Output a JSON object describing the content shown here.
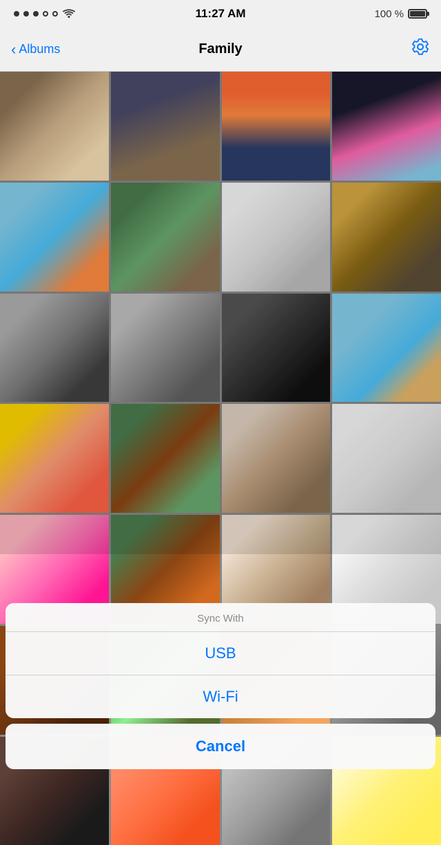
{
  "statusBar": {
    "time": "11:27 AM",
    "battery": "100 %"
  },
  "navBar": {
    "backLabel": "Albums",
    "title": "Family"
  },
  "photos": [
    {
      "id": 1,
      "class": "p1"
    },
    {
      "id": 2,
      "class": "p2"
    },
    {
      "id": 3,
      "class": "p3"
    },
    {
      "id": 4,
      "class": "p4"
    },
    {
      "id": 5,
      "class": "p5"
    },
    {
      "id": 6,
      "class": "p6"
    },
    {
      "id": 7,
      "class": "p7"
    },
    {
      "id": 8,
      "class": "p8"
    },
    {
      "id": 9,
      "class": "p9"
    },
    {
      "id": 10,
      "class": "p10"
    },
    {
      "id": 11,
      "class": "p11"
    },
    {
      "id": 12,
      "class": "p12"
    },
    {
      "id": 13,
      "class": "p13"
    },
    {
      "id": 14,
      "class": "p14"
    },
    {
      "id": 15,
      "class": "p15"
    },
    {
      "id": 16,
      "class": "p16"
    },
    {
      "id": 17,
      "class": "p17"
    },
    {
      "id": 18,
      "class": "p18"
    },
    {
      "id": 19,
      "class": "p19"
    },
    {
      "id": 20,
      "class": "p20"
    },
    {
      "id": 21,
      "class": "p21"
    },
    {
      "id": 22,
      "class": "p22"
    },
    {
      "id": 23,
      "class": "p23"
    },
    {
      "id": 24,
      "class": "p24"
    },
    {
      "id": 25,
      "class": "p25"
    },
    {
      "id": 26,
      "class": "p26"
    },
    {
      "id": 27,
      "class": "p27"
    },
    {
      "id": 28,
      "class": "p28"
    }
  ],
  "actionSheet": {
    "title": "Sync With",
    "options": [
      {
        "id": "usb",
        "label": "USB"
      },
      {
        "id": "wifi",
        "label": "Wi-Fi"
      }
    ],
    "cancelLabel": "Cancel"
  },
  "colors": {
    "accent": "#0076FF",
    "sheetBackground": "rgba(249,249,249,0.98)"
  }
}
